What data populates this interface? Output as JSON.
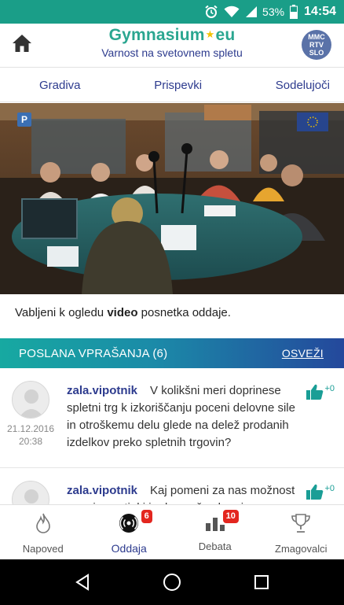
{
  "status_bar": {
    "battery_percent": "53%",
    "time": "14:54",
    "icons": [
      "alarm-icon",
      "wifi-icon",
      "signal-icon",
      "battery-icon"
    ]
  },
  "header": {
    "brand_left": "Gymnasium",
    "brand_right": "eu",
    "subtitle": "Varnost na svetovnem spletu",
    "partner_logo_lines": [
      "MMC",
      "RTV",
      "SLO"
    ]
  },
  "tabs": [
    {
      "label": "Gradiva"
    },
    {
      "label": "Prispevki"
    },
    {
      "label": "Sodelujoči"
    }
  ],
  "video": {
    "badge_letter": "P"
  },
  "caption": {
    "before": "Vabljeni k ogledu ",
    "bold": "video",
    "after": " posnetka oddaje."
  },
  "questions": {
    "title": "POSLANA VPRAŠANJA (6)",
    "refresh_label": "OSVEŽI",
    "items": [
      {
        "user": "zala.vipotnik",
        "text": "V kolikšni meri doprinese spletni trg k izkoriščanju poceni delovne sile in otroškemu delu glede na delež prodanih izdelkov preko spletnih trgovin?",
        "date": "21.12.2016",
        "time": "20:38",
        "likes": "+0"
      },
      {
        "user": "zala.vipotnik",
        "text": "Kaj pomeni za nas možnost anonimnosti, ki je danes že skoraj na",
        "likes": "+0"
      }
    ]
  },
  "bottom_nav": [
    {
      "label": "Napoved",
      "icon": "flame-icon",
      "badge": ""
    },
    {
      "label": "Oddaja",
      "icon": "broadcast-icon",
      "badge": "6"
    },
    {
      "label": "Debata",
      "icon": "bar-chart-icon",
      "badge": "10"
    },
    {
      "label": "Zmagovalci",
      "icon": "trophy-icon",
      "badge": ""
    }
  ],
  "colors": {
    "status_bar": "#1a9e88",
    "brand_green": "#2aa690",
    "navy": "#2d3b8e",
    "badge_red": "#e3261f",
    "like_teal": "#1a9e96"
  }
}
